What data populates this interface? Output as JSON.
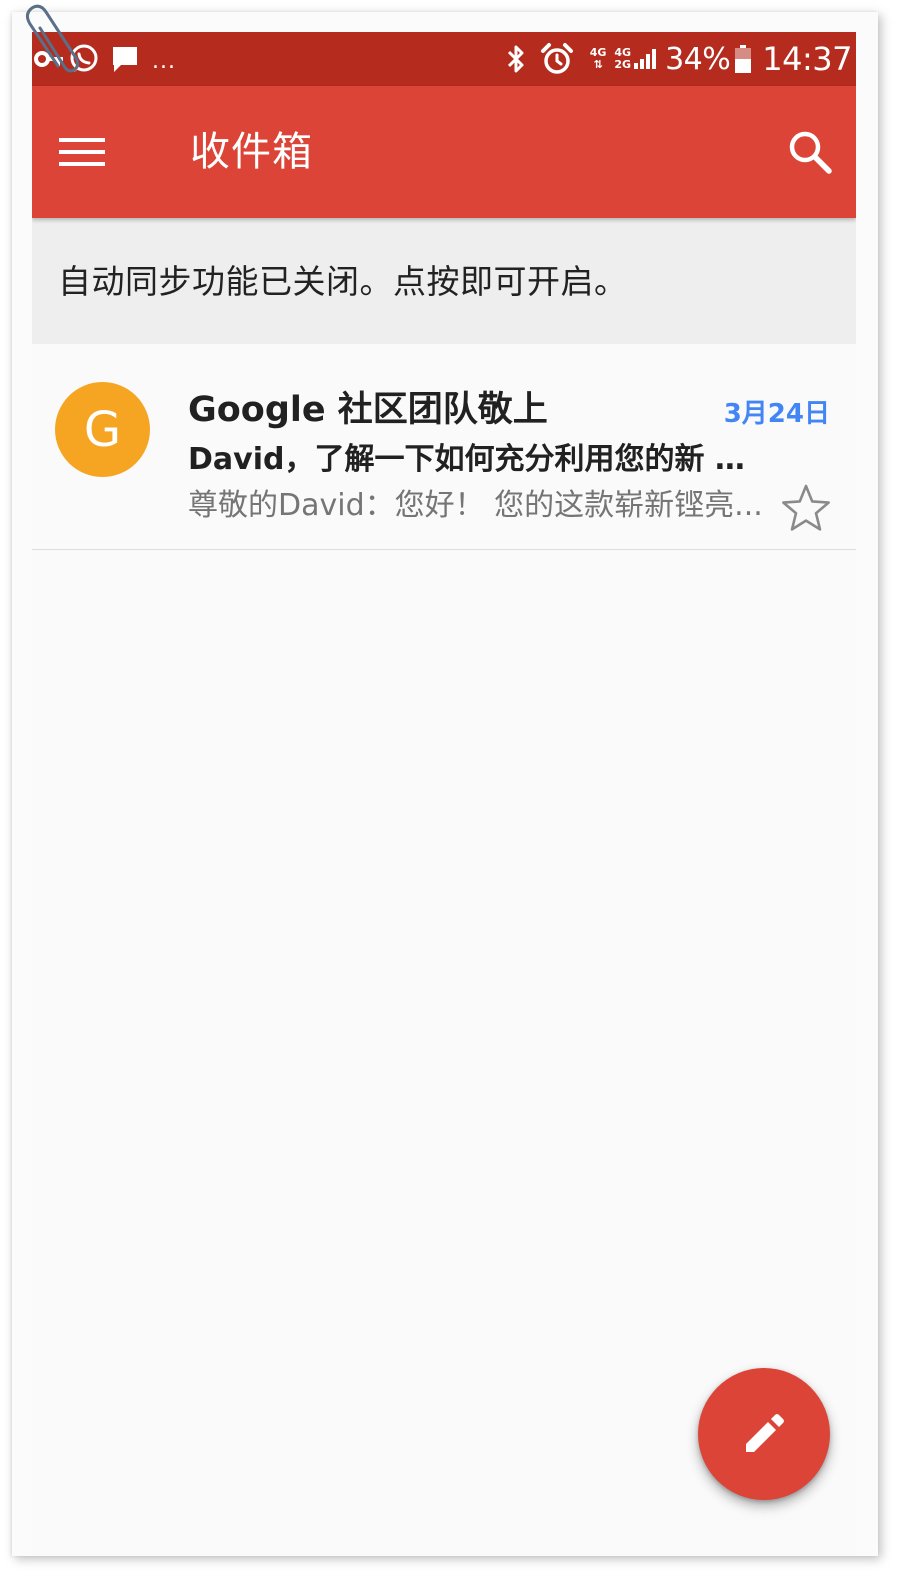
{
  "status_bar": {
    "left_icons": [
      "key-icon",
      "whatsapp-icon",
      "message-icon"
    ],
    "more": "...",
    "right_icons": [
      "bluetooth-icon",
      "alarm-icon",
      "signal-icon",
      "battery-icon"
    ],
    "net_4g": "4G",
    "net_4g_top": "4G",
    "net_2g": "2G",
    "battery": "34%",
    "time": "14:37"
  },
  "app_bar": {
    "title": "收件箱",
    "menu_icon": "hamburger-menu-icon",
    "search_icon": "search-icon"
  },
  "sync_banner": {
    "text": "自动同步功能已关闭。点按即可开启。"
  },
  "emails": [
    {
      "avatar_letter": "G",
      "avatar_color": "#f6a522",
      "sender": "Google 社区团队敬上",
      "date": "3月24日",
      "subject": "David，了解一下如何充分利用您的新 A...",
      "snippet": "尊敬的David：您好！ 您的这款崭新铿亮...",
      "starred": false
    }
  ],
  "fab": {
    "icon": "pencil-icon"
  },
  "colors": {
    "status_bar": "#b52c1f",
    "app_bar": "#db4437",
    "banner": "#eeeeee",
    "date": "#4285f4",
    "avatar": "#f6a522",
    "fab": "#db4437"
  }
}
